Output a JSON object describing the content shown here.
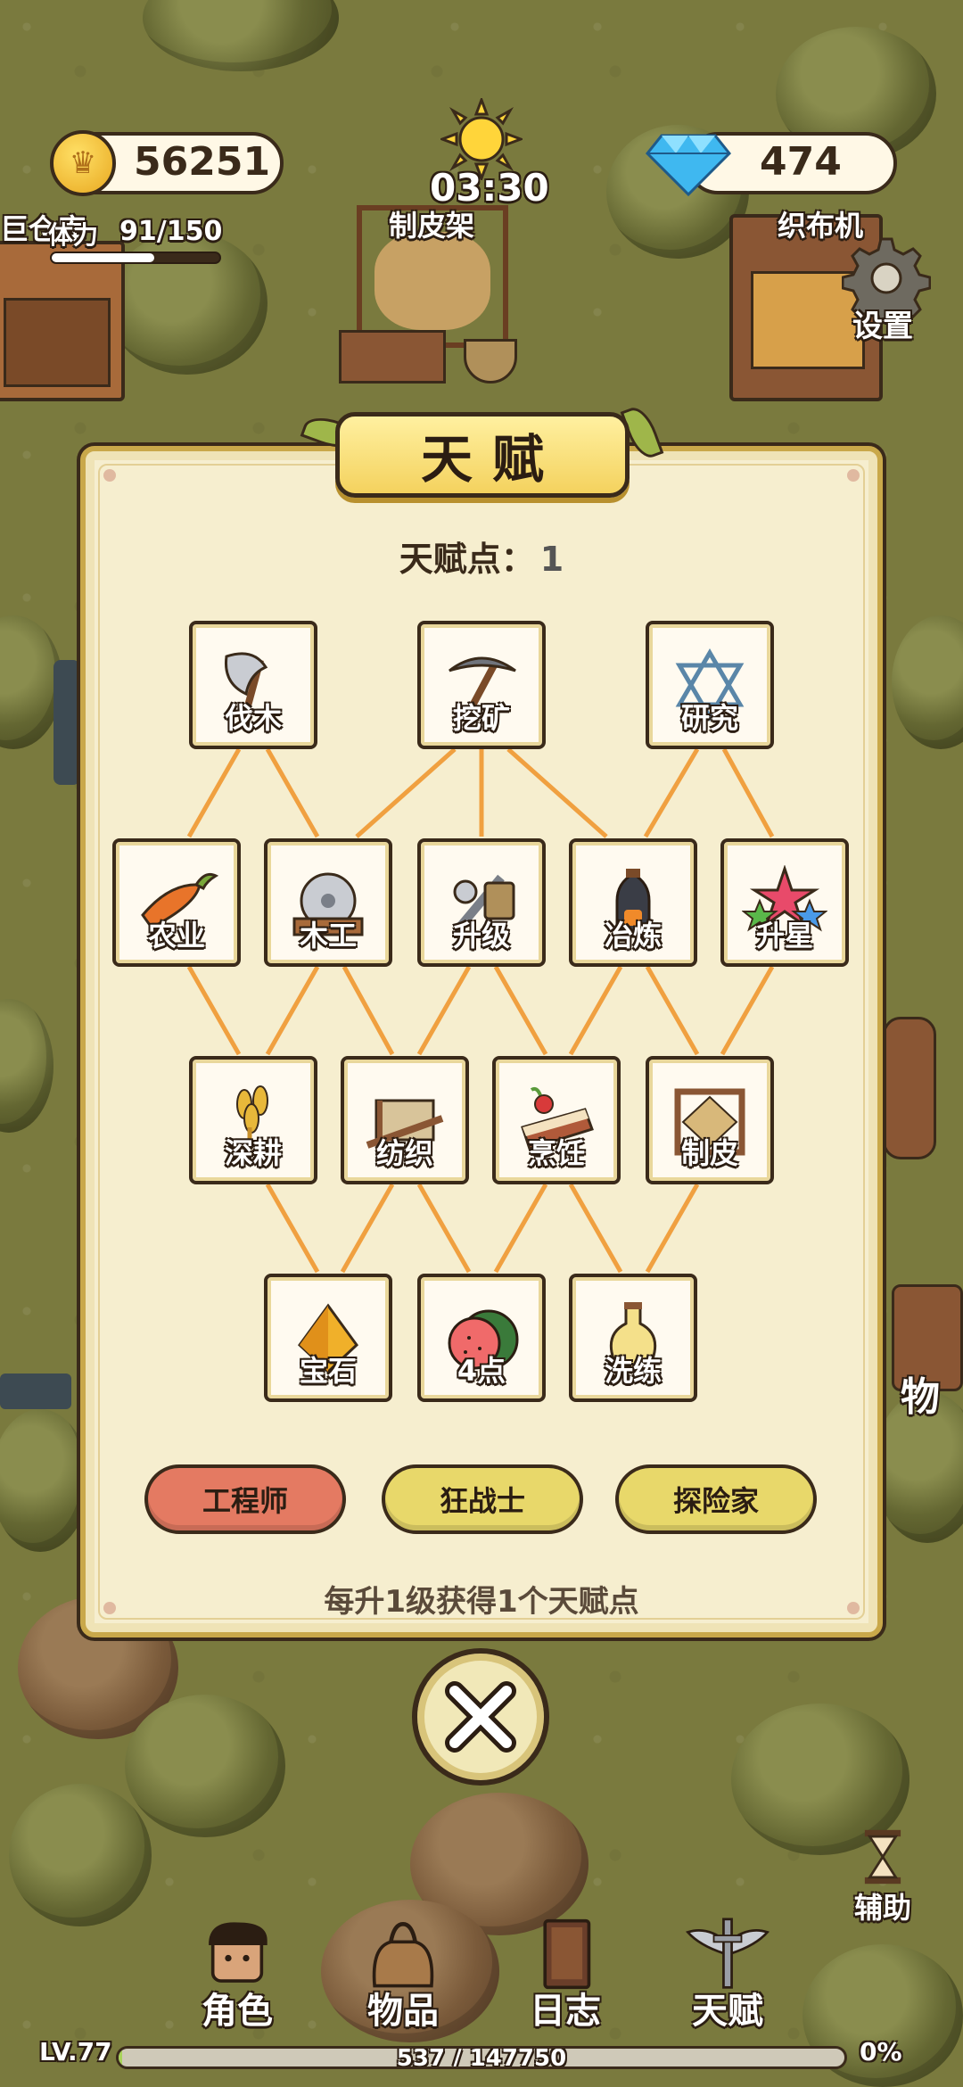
{
  "hud": {
    "coins": "56251",
    "gems": "474",
    "time": "03:30",
    "stamina_label": "体力",
    "stamina_value": "91/150",
    "stamina_fraction": 0.61,
    "warehouse_label": "巨仓库",
    "tanning_rack_label": "制皮架",
    "loom_label": "织布机",
    "settings_label": "设置"
  },
  "panel": {
    "title": "天赋",
    "points_label": "天赋点：",
    "points_value": "1",
    "footer_note": "每升1级获得1个天赋点"
  },
  "talents": {
    "row1": [
      {
        "label": "伐木",
        "icon": "axe-icon"
      },
      {
        "label": "挖矿",
        "icon": "pickaxe-icon"
      },
      {
        "label": "研究",
        "icon": "hexagram-icon"
      }
    ],
    "row2": [
      {
        "label": "农业",
        "icon": "carrot-icon"
      },
      {
        "label": "木工",
        "icon": "saw-icon"
      },
      {
        "label": "升级",
        "icon": "tools-icon"
      },
      {
        "label": "冶炼",
        "icon": "furnace-icon"
      },
      {
        "label": "升星",
        "icon": "stars-icon"
      }
    ],
    "row3": [
      {
        "label": "深耕",
        "icon": "wheat-icon"
      },
      {
        "label": "纺织",
        "icon": "loom-icon"
      },
      {
        "label": "烹饪",
        "icon": "cake-icon"
      },
      {
        "label": "制皮",
        "icon": "hide-frame-icon"
      }
    ],
    "row4": [
      {
        "label": "宝石",
        "icon": "gem-icon"
      },
      {
        "label": "4点",
        "icon": "watermelon-icon"
      },
      {
        "label": "洗练",
        "icon": "potion-icon"
      }
    ]
  },
  "classes": [
    {
      "label": "工程师",
      "color": "#e47a62",
      "selected": true
    },
    {
      "label": "狂战士",
      "color": "#e8d86a",
      "selected": false
    },
    {
      "label": "探险家",
      "color": "#e8d86a",
      "selected": false
    }
  ],
  "nav": {
    "items": [
      {
        "label": "角色",
        "icon": "character-icon"
      },
      {
        "label": "物品",
        "icon": "bag-icon"
      },
      {
        "label": "日志",
        "icon": "journal-icon"
      },
      {
        "label": "天赋",
        "icon": "wings-sword-icon"
      }
    ],
    "helper_label": "辅助",
    "side_label": "物"
  },
  "xp": {
    "level": "LV.77",
    "progress": "537 / 147750",
    "percent": "0%",
    "fraction": 0.004
  },
  "colors": {
    "panel_bg": "#f6eecf",
    "panel_border": "#c9a84a",
    "link_line": "#f0a040",
    "selected_class": "#e47a62",
    "unselected_class": "#e8d86a"
  }
}
